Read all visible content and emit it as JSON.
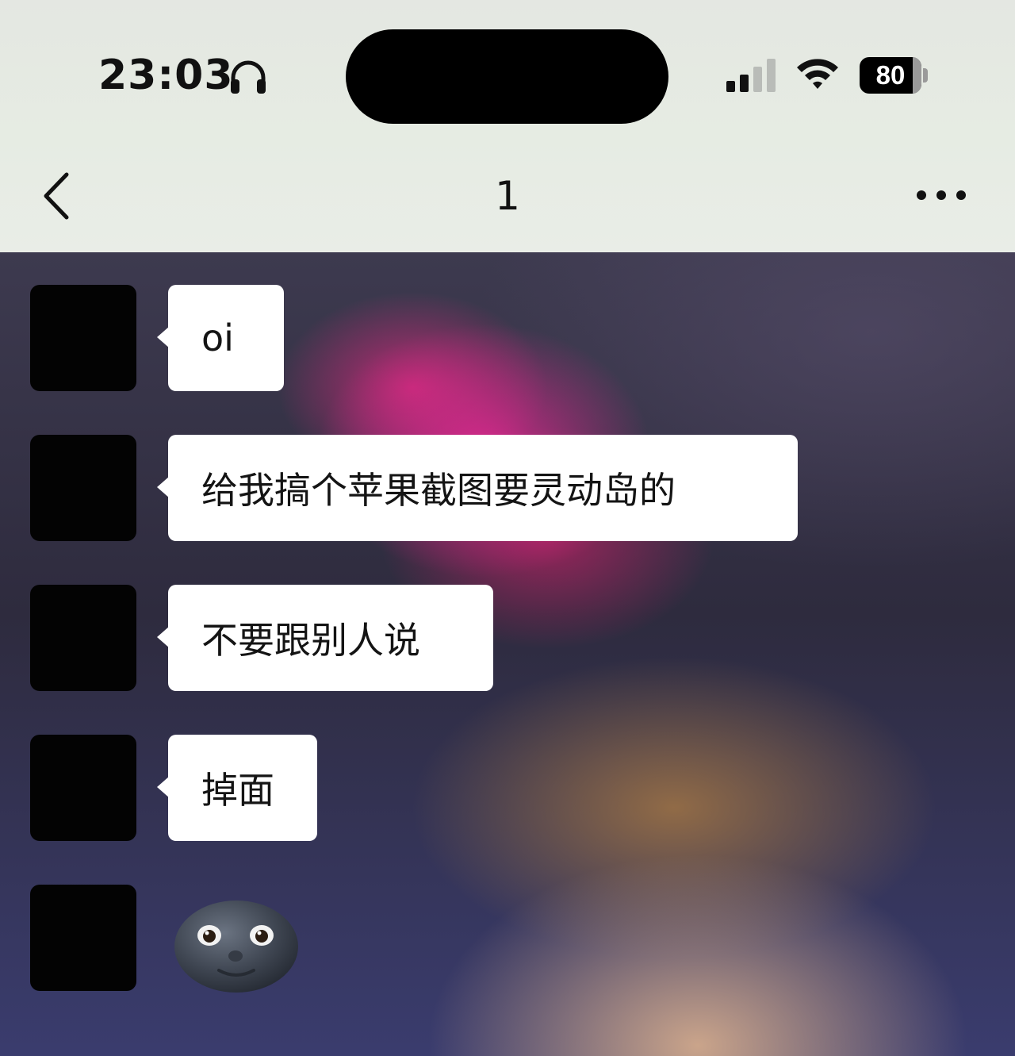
{
  "status_bar": {
    "time": "23:03",
    "battery": "80",
    "icons": [
      "headphones-icon",
      "signal-icon",
      "wifi-icon",
      "battery-icon"
    ]
  },
  "nav": {
    "back_icon": "chevron-left-icon",
    "title": "1",
    "more_icon": "more-horizontal-icon"
  },
  "messages": [
    {
      "type": "text",
      "text": "oi"
    },
    {
      "type": "text",
      "text": "给我搞个苹果截图要灵动岛的"
    },
    {
      "type": "text",
      "text": "不要跟别人说"
    },
    {
      "type": "text",
      "text": "掉面"
    },
    {
      "type": "emoji",
      "icon": "new-moon-face-icon"
    }
  ],
  "colors": {
    "bubble": "#ffffff",
    "avatar": "#030303",
    "header_bg": "#e6ece3"
  }
}
